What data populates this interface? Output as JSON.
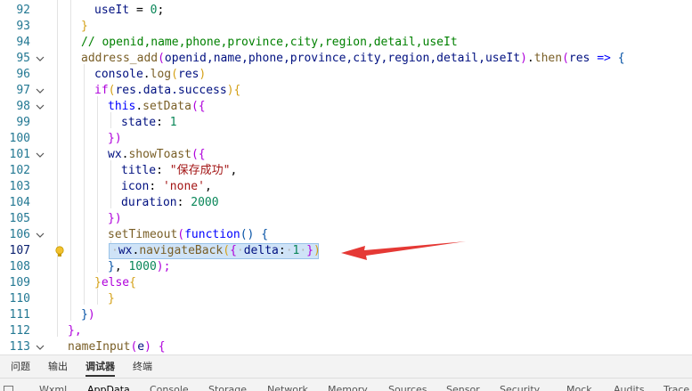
{
  "editor": {
    "lines": [
      {
        "num": "92",
        "fold": false,
        "indent": 1
      },
      {
        "num": "93",
        "fold": false,
        "indent": 1
      },
      {
        "num": "94",
        "fold": false,
        "indent": 1
      },
      {
        "num": "95",
        "fold": true,
        "indent": 1
      },
      {
        "num": "96",
        "fold": false,
        "indent": 2
      },
      {
        "num": "97",
        "fold": true,
        "indent": 2
      },
      {
        "num": "98",
        "fold": true,
        "indent": 3
      },
      {
        "num": "99",
        "fold": false,
        "indent": 4
      },
      {
        "num": "100",
        "fold": false,
        "indent": 3
      },
      {
        "num": "101",
        "fold": true,
        "indent": 3
      },
      {
        "num": "102",
        "fold": false,
        "indent": 4
      },
      {
        "num": "103",
        "fold": false,
        "indent": 4
      },
      {
        "num": "104",
        "fold": false,
        "indent": 4
      },
      {
        "num": "105",
        "fold": false,
        "indent": 3
      },
      {
        "num": "106",
        "fold": true,
        "indent": 3
      },
      {
        "num": "107",
        "fold": false,
        "indent": 4
      },
      {
        "num": "108",
        "fold": false,
        "indent": 3
      },
      {
        "num": "109",
        "fold": false,
        "indent": 2
      },
      {
        "num": "110",
        "fold": false,
        "indent": 3
      },
      {
        "num": "111",
        "fold": false,
        "indent": 2
      },
      {
        "num": "112",
        "fold": false,
        "indent": 1
      },
      {
        "num": "113",
        "fold": true,
        "indent": 0
      }
    ],
    "code": {
      "l92_a": "useIt",
      "l92_b": " = ",
      "l92_c": "0",
      "l92_d": ";",
      "l93": "}",
      "l94": "// openid,name,phone,province,city,region,detail,useIt",
      "l95_fn": "address_add",
      "l95_p1": "(",
      "l95_args": "openid,name,phone,province,city,region,detail,useIt",
      "l95_p2": ")",
      "l95_dot": ".",
      "l95_then": "then",
      "l95_p3": "(",
      "l95_res": "res",
      "l95_arrow": " => ",
      "l95_b": "{",
      "l96_a": "console",
      "l96_dot": ".",
      "l96_log": "log",
      "l96_p1": "(",
      "l96_res": "res",
      "l96_p2": ")",
      "l97_if": "if",
      "l97_p1": "(",
      "l97_expr": "res.data.success",
      "l97_p2": ")",
      "l97_b": "{",
      "l98_this": "this",
      "l98_dot": ".",
      "l98_fn": "setData",
      "l98_p": "(",
      "l98_b": "{",
      "l99_key": "state",
      "l99_colon": ": ",
      "l99_val": "1",
      "l100_b": "}",
      "l100_p": ")",
      "l101_wx": "wx",
      "l101_dot": ".",
      "l101_fn": "showToast",
      "l101_p": "(",
      "l101_b": "{",
      "l102_key": "title",
      "l102_colon": ": ",
      "l102_val": "\"保存成功\"",
      "l102_comma": ",",
      "l103_key": "icon",
      "l103_colon": ": ",
      "l103_val": "'none'",
      "l103_comma": ",",
      "l104_key": "duration",
      "l104_colon": ": ",
      "l104_val": "2000",
      "l105_b": "}",
      "l105_p": ")",
      "l106_fn": "setTimeout",
      "l106_p": "(",
      "l106_kw": "function",
      "l106_pp": "() ",
      "l106_b": "{",
      "l107_ws1": "·",
      "l107_wx": "wx",
      "l107_dot": ".",
      "l107_fn": "navigateBack",
      "l107_p1": "(",
      "l107_b1": "{",
      "l107_ws2": "·",
      "l107_key": "delta",
      "l107_colon": ":",
      "l107_ws3": "·",
      "l107_val": "1",
      "l107_ws4": "·",
      "l107_b2": "}",
      "l107_p2": ")",
      "l108_b": "}",
      "l108_rest": ", ",
      "l108_val": "1000",
      "l108_p": ");",
      "l109_b1": "}",
      "l109_else": "else",
      "l109_b2": "{",
      "l110_b": "}",
      "l111_b": "}",
      "l111_p": ")",
      "l112": "},",
      "l113_fn": "nameInput",
      "l113_p": "(",
      "l113_e": "e",
      "l113_p2": ") ",
      "l113_b": "{"
    }
  },
  "colors": {
    "annotation_arrow": "#e53935",
    "selection": "#add6ff",
    "line_number": "#237893"
  },
  "panel": {
    "tabs": [
      "问题",
      "输出",
      "调试器",
      "终端"
    ],
    "active_tab": "调试器",
    "subtabs": [
      "Wxml",
      "AppData",
      "Console",
      "Storage",
      "Network",
      "Memory",
      "Sources",
      "Sensor",
      "Security",
      "Mock",
      "Audits",
      "Trace"
    ]
  }
}
